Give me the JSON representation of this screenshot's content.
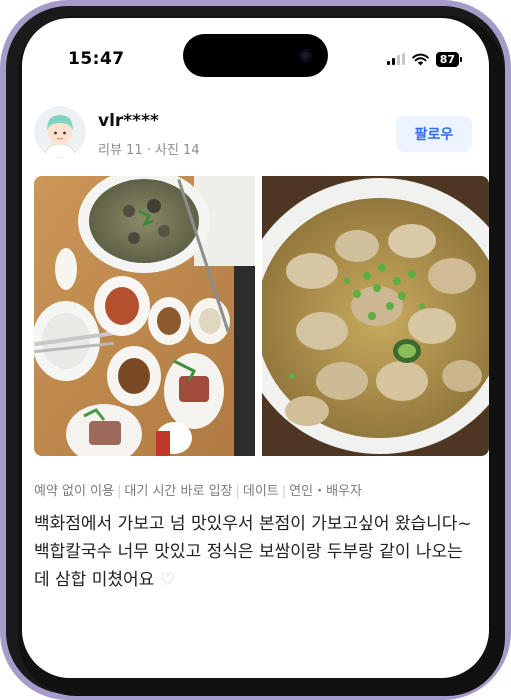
{
  "status_bar": {
    "time": "15:47",
    "battery": "87"
  },
  "profile": {
    "username": "vlr****",
    "stats": "리뷰 11 · 사진 14",
    "follow_label": "팔로우"
  },
  "photos": [
    {
      "subject": "clam-noodle-set-meal"
    },
    {
      "subject": "clam-kalguksu-bowl"
    }
  ],
  "tags": [
    "예약 없이 이용",
    "대기 시간 바로 입장",
    "데이트",
    "연인・배우자"
  ],
  "review": {
    "text": "백화점에서 가보고 넘 맛있우서 본점이 가보고싶어 왔습니다~\n백합칼국수 너무 맛있고 정식은 보쌈이랑 두부랑 같이 나오는데 삼합 미쳤어요"
  },
  "colors": {
    "frame": "#a79cc9",
    "accent": "#2b6cf6",
    "follow_bg": "#eef4ff"
  }
}
